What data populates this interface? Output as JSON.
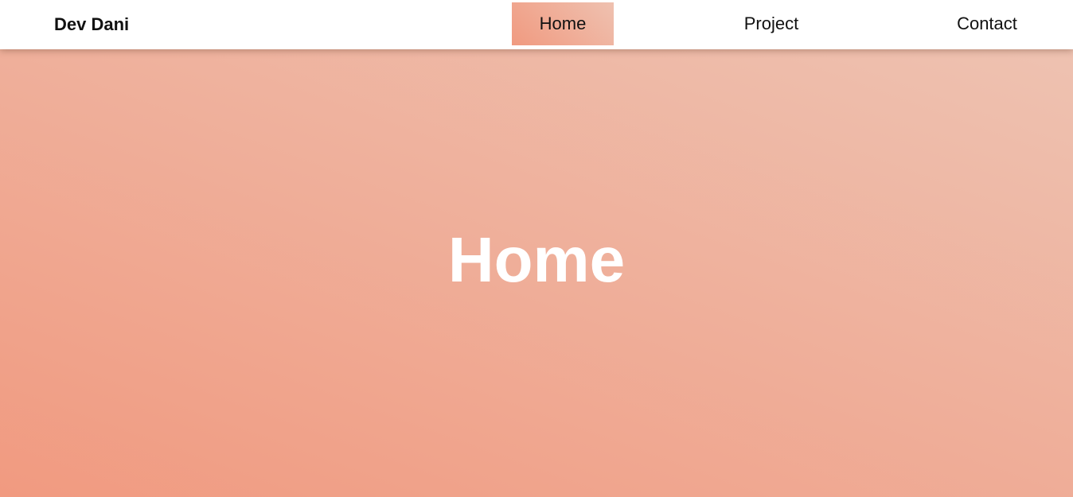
{
  "brand": {
    "name": "Dev Dani"
  },
  "nav": {
    "items": [
      {
        "label": "Home",
        "active": true
      },
      {
        "label": "Project",
        "active": false
      },
      {
        "label": "Contact",
        "active": false
      }
    ]
  },
  "hero": {
    "title": "Home"
  },
  "colors": {
    "accent_start": "#f09a80",
    "accent_end": "#efc1b0",
    "hero_text": "#ffffff",
    "nav_background": "#ffffff"
  }
}
